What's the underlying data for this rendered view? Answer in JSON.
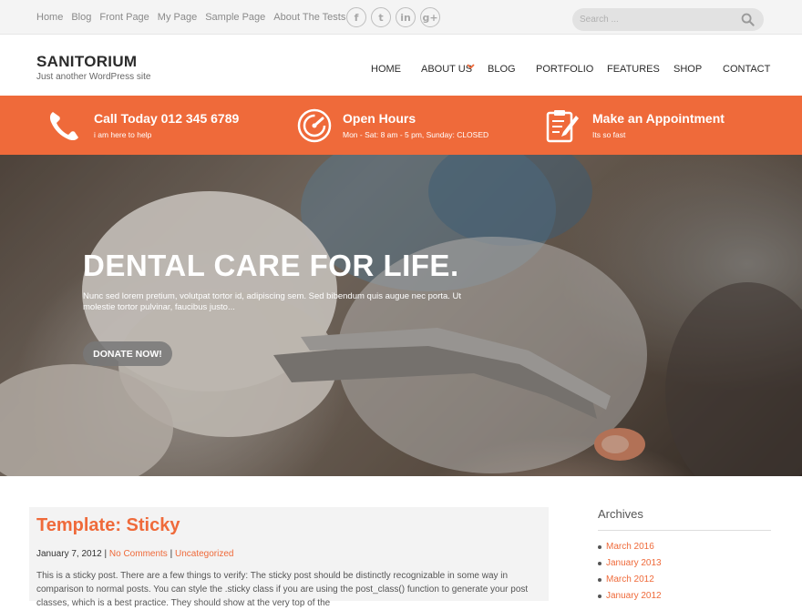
{
  "topbar": {
    "links": [
      "Home",
      "Blog",
      "Front Page",
      "My Page",
      "Sample Page",
      "About The Tests"
    ],
    "social_icons": [
      "facebook-icon",
      "twitter-icon",
      "linkedin-icon",
      "google-plus-icon"
    ],
    "social_glyphs": [
      "f",
      "t",
      "in",
      "g+"
    ],
    "search_placeholder": "Search ..."
  },
  "header": {
    "site_title": "SANITORIUM",
    "tagline": "Just another WordPress site",
    "nav": [
      "HOME",
      "ABOUT US",
      "BLOG",
      "PORTFOLIO",
      "FEATURES",
      "SHOP",
      "CONTACT"
    ]
  },
  "infobar": {
    "items": [
      {
        "icon": "phone-icon",
        "title": "Call Today 012 345 6789",
        "subtitle": "i am here to help"
      },
      {
        "icon": "speedometer-icon",
        "title": "Open Hours",
        "subtitle": "Mon - Sat: 8 am - 5 pm, Sunday: CLOSED"
      },
      {
        "icon": "clipboard-pencil-icon",
        "title": "Make an Appointment",
        "subtitle": "Its so fast"
      }
    ]
  },
  "hero": {
    "title": "DENTAL CARE FOR LIFE.",
    "text": "Nunc sed lorem pretium, volutpat tortor id, adipiscing sem. Sed bibendum quis augue nec porta. Ut molestie tortor pulvinar, faucibus justo...",
    "button": "DONATE NOW!"
  },
  "post": {
    "title": "Template: Sticky",
    "date": "January 7, 2012",
    "separator": "|",
    "comments": "No Comments",
    "category": "Uncategorized",
    "excerpt": "This is a sticky post. There are a few things to verify: The sticky post should be distinctly recognizable in some way in comparison to normal posts. You can style the .sticky class if you are using the post_class() function to generate your post classes, which is a best practice. They should show at the very top of the"
  },
  "sidebar": {
    "title": "Archives",
    "archives": [
      "March 2016",
      "January 2013",
      "March 2012",
      "January 2012"
    ]
  },
  "colors": {
    "accent": "#ef6a3a",
    "topbar_bg": "#f4f4f4",
    "text_dark": "#2b2b2b"
  }
}
